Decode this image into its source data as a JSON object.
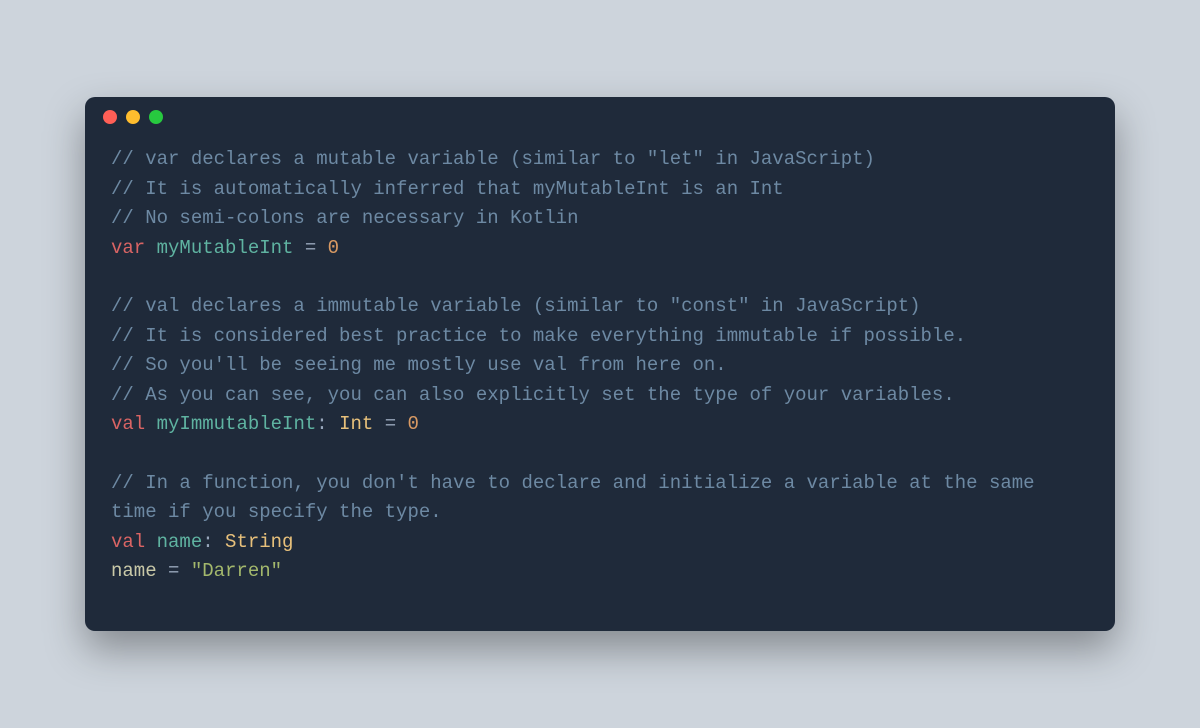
{
  "window": {
    "traffic_lights": [
      "close",
      "minimize",
      "zoom"
    ]
  },
  "code": {
    "lines": [
      {
        "tokens": [
          {
            "t": "// var declares a mutable variable (similar to \"let\" in JavaScript)",
            "c": "comment"
          }
        ]
      },
      {
        "tokens": [
          {
            "t": "// It is automatically inferred that myMutableInt is an Int",
            "c": "comment"
          }
        ]
      },
      {
        "tokens": [
          {
            "t": "// No semi-colons are necessary in Kotlin",
            "c": "comment"
          }
        ]
      },
      {
        "tokens": [
          {
            "t": "var",
            "c": "keyword"
          },
          {
            "t": " ",
            "c": "plain"
          },
          {
            "t": "myMutableInt",
            "c": "ident"
          },
          {
            "t": " = ",
            "c": "op"
          },
          {
            "t": "0",
            "c": "number"
          }
        ]
      },
      {
        "tokens": [
          {
            "t": " ",
            "c": "plain"
          }
        ]
      },
      {
        "tokens": [
          {
            "t": "// val declares a immutable variable (similar to \"const\" in JavaScript)",
            "c": "comment"
          }
        ]
      },
      {
        "tokens": [
          {
            "t": "// It is considered best practice to make everything immutable if possible.",
            "c": "comment"
          }
        ]
      },
      {
        "tokens": [
          {
            "t": "// So you'll be seeing me mostly use val from here on.",
            "c": "comment"
          }
        ]
      },
      {
        "tokens": [
          {
            "t": "// As you can see, you can also explicitly set the type of your variables.",
            "c": "comment"
          }
        ]
      },
      {
        "tokens": [
          {
            "t": "val",
            "c": "keyword"
          },
          {
            "t": " ",
            "c": "plain"
          },
          {
            "t": "myImmutableInt",
            "c": "ident"
          },
          {
            "t": ": ",
            "c": "op"
          },
          {
            "t": "Int",
            "c": "type"
          },
          {
            "t": " = ",
            "c": "op"
          },
          {
            "t": "0",
            "c": "number"
          }
        ]
      },
      {
        "tokens": [
          {
            "t": " ",
            "c": "plain"
          }
        ]
      },
      {
        "tokens": [
          {
            "t": "// In a function, you don't have to declare and initialize a variable at the same time if you specify the type.",
            "c": "comment"
          }
        ]
      },
      {
        "tokens": [
          {
            "t": "val",
            "c": "keyword"
          },
          {
            "t": " ",
            "c": "plain"
          },
          {
            "t": "name",
            "c": "ident"
          },
          {
            "t": ": ",
            "c": "op"
          },
          {
            "t": "String",
            "c": "type"
          }
        ]
      },
      {
        "tokens": [
          {
            "t": "name",
            "c": "plain"
          },
          {
            "t": " = ",
            "c": "op"
          },
          {
            "t": "\"Darren\"",
            "c": "string"
          }
        ]
      }
    ]
  }
}
